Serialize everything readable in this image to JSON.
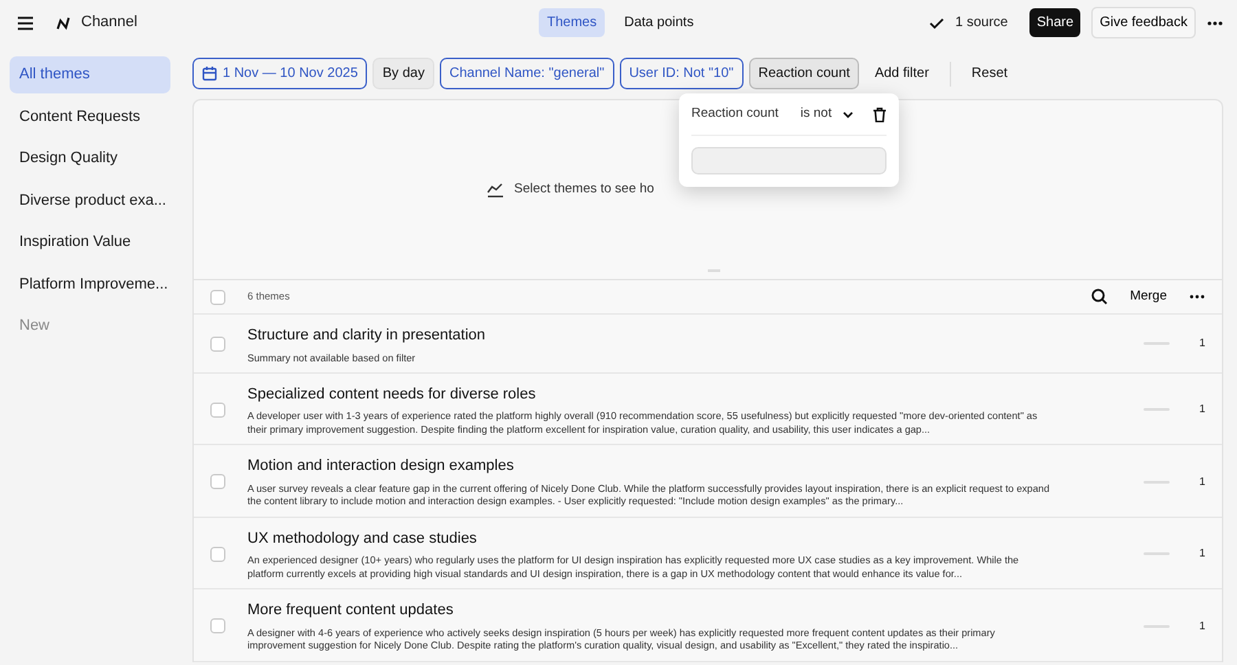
{
  "header": {
    "title": "Channel",
    "tabs": [
      {
        "label": "Themes",
        "selected": true
      },
      {
        "label": "Data points",
        "selected": false
      }
    ],
    "source": "1 source",
    "share": "Share",
    "feedback": "Give feedback"
  },
  "sidebar": {
    "items": [
      {
        "label": "All themes",
        "selected": true,
        "kind": "item"
      },
      {
        "label": "Content Requests",
        "selected": false,
        "kind": "item"
      },
      {
        "label": "Design Quality",
        "selected": false,
        "kind": "item"
      },
      {
        "label": "Diverse product exa...",
        "selected": false,
        "kind": "item"
      },
      {
        "label": "Inspiration Value",
        "selected": false,
        "kind": "item"
      },
      {
        "label": "Platform Improveme...",
        "selected": false,
        "kind": "item"
      },
      {
        "label": "New",
        "selected": false,
        "kind": "new"
      }
    ]
  },
  "filters": [
    {
      "label": "1 Nov — 10 Nov 2025",
      "kind": "date"
    },
    {
      "label": "By day",
      "kind": "plain"
    },
    {
      "label": "Channel Name: \"general\"",
      "kind": "filter"
    },
    {
      "label": "User ID: Not \"10\"",
      "kind": "filter"
    },
    {
      "label": "Reaction count",
      "kind": "open"
    },
    {
      "label": "Add filter",
      "kind": "text"
    },
    {
      "label": "Reset",
      "kind": "reset"
    }
  ],
  "popover": {
    "field": "Reaction count",
    "operator": "is not"
  },
  "chart_panel": {
    "message": "Select themes to see ho"
  },
  "list": {
    "count": "6 themes",
    "checked": false,
    "merge": "Merge"
  },
  "themes": [
    {
      "title": "Structure and clarity in presentation",
      "summary": "Summary not available based on filter",
      "count": "1",
      "checked": false
    },
    {
      "title": "Specialized content needs for diverse roles",
      "summary": "A developer user with 1-3 years of experience rated the platform highly overall (910 recommendation score, 55 usefulness) but explicitly requested \"more dev-oriented content\" as their primary improvement suggestion. Despite finding the platform excellent for inspiration value, curation quality, and usability, this user indicates a gap...",
      "count": "1",
      "checked": false
    },
    {
      "title": "Motion and interaction design examples",
      "summary": "A user survey reveals a clear feature gap in the current offering of Nicely Done Club. While the platform successfully provides layout inspiration, there is an explicit request to expand the content library to include motion and interaction design examples. - User explicitly requested: \"Include motion design examples\" as the primary...",
      "count": "1",
      "checked": false
    },
    {
      "title": "UX methodology and case studies",
      "summary": "An experienced designer (10+ years) who regularly uses the platform for UI design inspiration has explicitly requested more UX case studies as a key improvement. While the platform currently excels at providing high visual standards and UI design inspiration, there is a gap in UX methodology content that would enhance its value for...",
      "count": "1",
      "checked": false
    },
    {
      "title": "More frequent content updates",
      "summary": "A designer with 4-6 years of experience who actively seeks design inspiration (5 hours per week) has explicitly requested more frequent content updates as their primary improvement suggestion for Nicely Done Club. Despite rating the platform's curation quality, visual design, and usability as \"Excellent,\" they rated the inspiratio...",
      "count": "1",
      "checked": false
    }
  ]
}
